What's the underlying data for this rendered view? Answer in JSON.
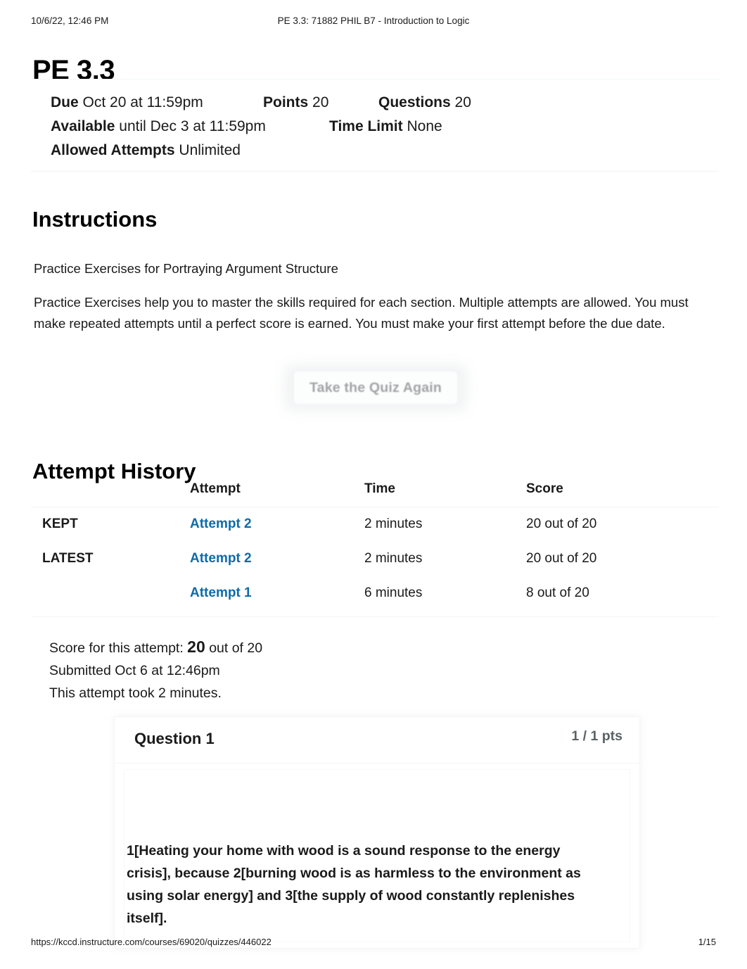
{
  "print_header": {
    "date": "10/6/22, 12:46 PM",
    "title": "PE 3.3: 71882 PHIL B7 - Introduction to Logic"
  },
  "page_title": "PE 3.3",
  "quiz_meta": {
    "due_label": "Due",
    "due_value": "Oct 20 at 11:59pm",
    "points_label": "Points",
    "points_value": "20",
    "questions_label": "Questions",
    "questions_value": "20",
    "available_label": "Available",
    "available_value": "until Dec 3 at 11:59pm",
    "time_limit_label": "Time Limit",
    "time_limit_value": "None",
    "allowed_attempts_label": "Allowed Attempts",
    "allowed_attempts_value": "Unlimited"
  },
  "instructions": {
    "heading": "Instructions",
    "paragraph_1": "Practice Exercises for Portraying Argument Structure",
    "paragraph_2": "Practice Exercises help you to master the skills required for each section. Multiple attempts are allowed. You must make repeated attempts until a perfect score is earned. You must make your first attempt before the due date."
  },
  "take_quiz_again_button": "Take the Quiz Again",
  "attempt_history": {
    "heading": "Attempt History",
    "columns": [
      "",
      "Attempt",
      "Time",
      "Score"
    ],
    "rows": [
      {
        "label": "KEPT",
        "attempt": "Attempt 2",
        "time": "2 minutes",
        "score": "20 out of 20"
      },
      {
        "label": "LATEST",
        "attempt": "Attempt 2",
        "time": "2 minutes",
        "score": "20 out of 20"
      },
      {
        "label": "",
        "attempt": "Attempt 1",
        "time": "6 minutes",
        "score": "8 out of 20"
      }
    ]
  },
  "score_summary": {
    "score_prefix": "Score for this attempt:",
    "score_value": "20",
    "score_suffix": "out of 20",
    "submitted": "Submitted Oct 6 at 12:46pm",
    "duration": "This attempt took 2 minutes."
  },
  "question": {
    "title": "Question 1",
    "points": "1 / 1 pts",
    "text": "1[Heating your home with wood is a sound response to the energy crisis], because 2[burning wood is as harmless to the environment as using solar energy] and 3[the supply of wood constantly replenishes itself]."
  },
  "print_footer": {
    "url": "https://kccd.instructure.com/courses/69020/quizzes/446022",
    "page": "1/15"
  },
  "colors": {
    "link_blue": "#0e6ba8",
    "text": "#1a1a1a",
    "muted": "#5a6265",
    "disabled_button_text": "#a0a4a7"
  }
}
